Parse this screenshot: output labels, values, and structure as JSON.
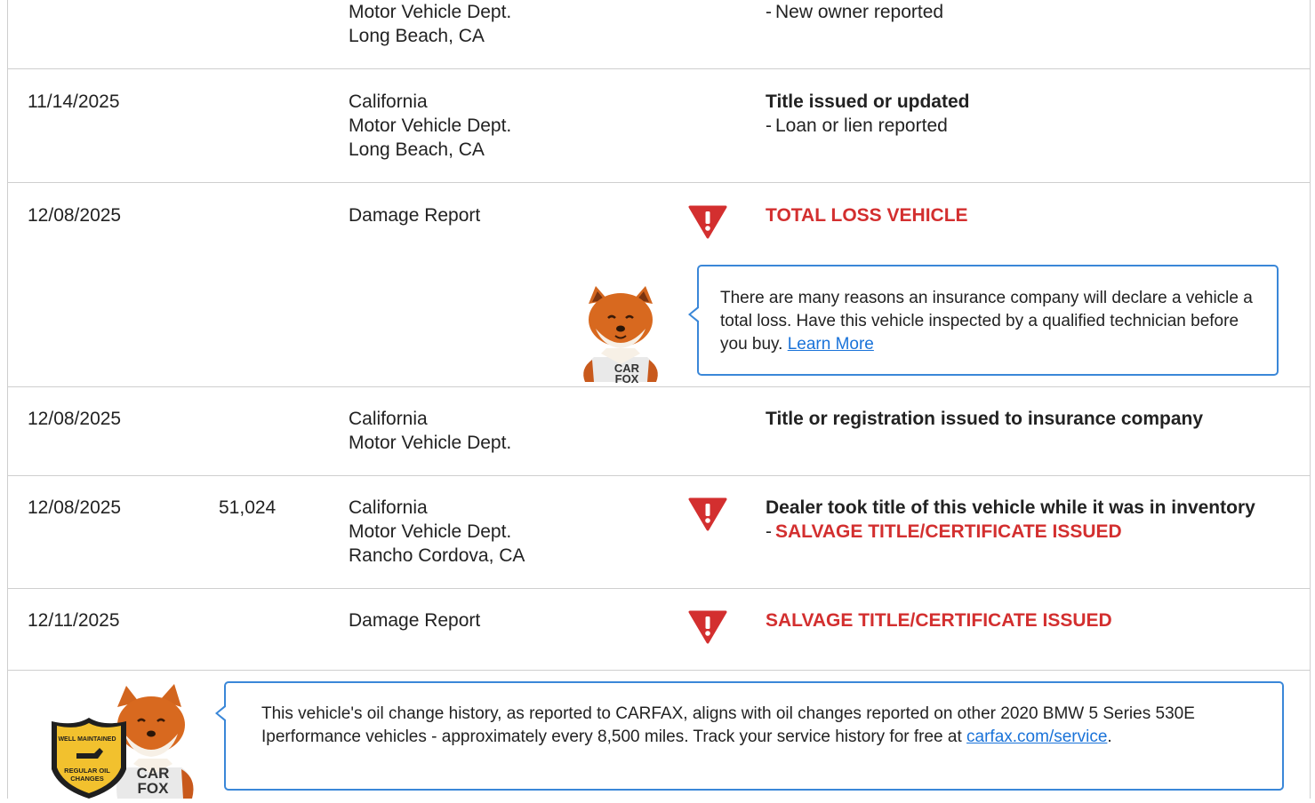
{
  "rows": [
    {
      "date": "",
      "odometer": "",
      "source": [
        "Motor Vehicle Dept.",
        "Long Beach, CA"
      ],
      "comment_lines": [
        "New owner reported"
      ]
    },
    {
      "date": "11/14/2025",
      "odometer": "",
      "source": [
        "California",
        "Motor Vehicle Dept.",
        "Long Beach, CA"
      ],
      "comment_title": "Title issued or updated",
      "comment_lines": [
        "Loan or lien reported"
      ]
    },
    {
      "date": "12/08/2025",
      "odometer": "",
      "source": [
        "Damage Report"
      ],
      "comment_title": "TOTAL LOSS VEHICLE",
      "alert_icon": "warning-triangle-icon",
      "tip": {
        "text": "There are many reasons an insurance company will declare a vehicle a total loss. Have this vehicle inspected by a qualified technician before you buy.",
        "link": "Learn More"
      },
      "mascot_shirt": [
        "CAR",
        "FOX"
      ]
    },
    {
      "date": "12/08/2025",
      "odometer": "",
      "source": [
        "California",
        "Motor Vehicle Dept."
      ],
      "comment_title": "Title or registration issued to insurance company"
    },
    {
      "date": "12/08/2025",
      "odometer": "51,024",
      "source": [
        "California",
        "Motor Vehicle Dept.",
        "Rancho Cordova, CA"
      ],
      "comment_title": "Dealer took title of this vehicle while it was in inventory",
      "comment_red_lines": [
        "SALVAGE TITLE/CERTIFICATE ISSUED"
      ],
      "alert_icon": "warning-triangle-icon"
    },
    {
      "date": "12/11/2025",
      "odometer": "",
      "source": [
        "Damage Report"
      ],
      "comment_title": "SALVAGE TITLE/CERTIFICATE ISSUED",
      "alert_icon": "warning-triangle-icon"
    }
  ],
  "oil_note": {
    "text": "This vehicle's oil change history, as reported to CARFAX, aligns with oil changes reported on other 2020 BMW 5 Series 530E Iperformance vehicles - approximately every 8,500 miles. Track your service history for free at",
    "link": "carfax.com/service",
    "tail": ".",
    "badge_lines": [
      "WELL MAINTAINED",
      "REGULAR OIL",
      "CHANGES"
    ],
    "mascot_shirt": [
      "CAR",
      "FOX"
    ]
  },
  "colors": {
    "alert_red": "#d32f2f",
    "tip_border": "#3a87d8",
    "link": "#1a73d9",
    "badge_gold": "#f2c12e"
  }
}
